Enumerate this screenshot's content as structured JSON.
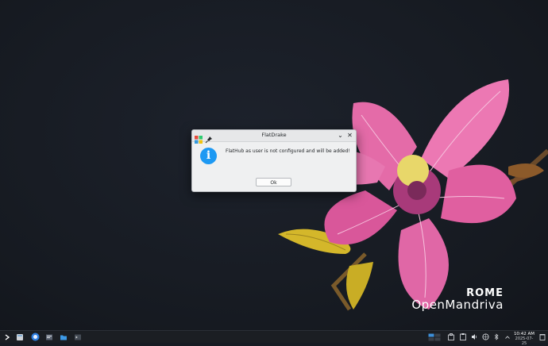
{
  "wallpaper": {
    "brand_line1": "ROME",
    "brand_line2": "OpenMandriva"
  },
  "dialog": {
    "title": "FlatDrake",
    "message": "FlatHub as user is not configured and will be added!",
    "ok_label": "Ok",
    "icon": "information-icon",
    "accent": "#1d99f3"
  },
  "taskbar": {
    "time": "10:42 AM",
    "date": "2025-07-25",
    "launchers": [
      "application-launcher",
      "file-manager",
      "web-browser",
      "task-manager",
      "files",
      "terminal"
    ],
    "tray": [
      "vault",
      "clipboard",
      "volume",
      "network",
      "bluetooth",
      "display",
      "notifications",
      "tray-expand"
    ]
  }
}
